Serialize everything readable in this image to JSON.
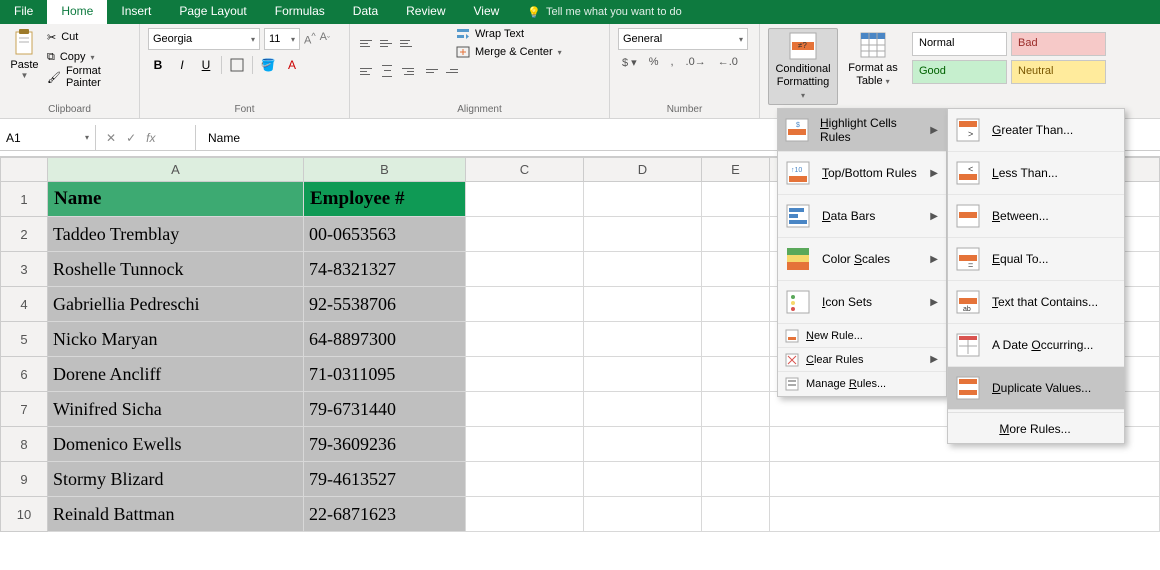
{
  "tabs": {
    "file": "File",
    "home": "Home",
    "insert": "Insert",
    "page_layout": "Page Layout",
    "formulas": "Formulas",
    "data": "Data",
    "review": "Review",
    "view": "View",
    "tell_me": "Tell me what you want to do"
  },
  "ribbon": {
    "clipboard": {
      "paste": "Paste",
      "cut": "Cut",
      "copy": "Copy",
      "format_painter": "Format Painter",
      "title": "Clipboard"
    },
    "font": {
      "name": "Georgia",
      "size": "11",
      "bold": "B",
      "italic": "I",
      "underline": "U",
      "title": "Font"
    },
    "alignment": {
      "wrap": "Wrap Text",
      "merge": "Merge & Center",
      "title": "Alignment"
    },
    "number": {
      "format": "General",
      "title": "Number"
    },
    "styles": {
      "conditional": "Conditional Formatting",
      "format_table": "Format as Table",
      "normal": "Normal",
      "bad": "Bad",
      "good": "Good",
      "neutral": "Neutral"
    }
  },
  "formula_bar": {
    "ref": "A1",
    "fx": "fx",
    "content": "Name"
  },
  "columns": [
    "A",
    "B",
    "C",
    "D",
    "E"
  ],
  "table": {
    "headers": {
      "name": "Name",
      "emp": "Employee #"
    },
    "rows": [
      {
        "name": "Taddeo Tremblay",
        "emp": "00-0653563"
      },
      {
        "name": "Roshelle Tunnock",
        "emp": "74-8321327"
      },
      {
        "name": "Gabriellia Pedreschi",
        "emp": "92-5538706"
      },
      {
        "name": "Nicko Maryan",
        "emp": "64-8897300"
      },
      {
        "name": "Dorene Ancliff",
        "emp": "71-0311095"
      },
      {
        "name": "Winifred Sicha",
        "emp": "79-6731440"
      },
      {
        "name": "Domenico Ewells",
        "emp": "79-3609236"
      },
      {
        "name": "Stormy Blizard",
        "emp": "79-4613527"
      },
      {
        "name": "Reinald Battman",
        "emp": "22-6871623"
      }
    ]
  },
  "menu1": {
    "highlight": "Highlight Cells Rules",
    "topbottom": "Top/Bottom Rules",
    "databars": "Data Bars",
    "colorscales": "Color Scales",
    "iconsets": "Icon Sets",
    "newrule": "New Rule...",
    "clear": "Clear Rules",
    "manage": "Manage Rules..."
  },
  "menu2": {
    "gt": "Greater Than...",
    "lt": "Less Than...",
    "between": "Between...",
    "equal": "Equal To...",
    "text": "Text that Contains...",
    "date": "A Date Occurring...",
    "dup": "Duplicate Values...",
    "more": "More Rules..."
  }
}
